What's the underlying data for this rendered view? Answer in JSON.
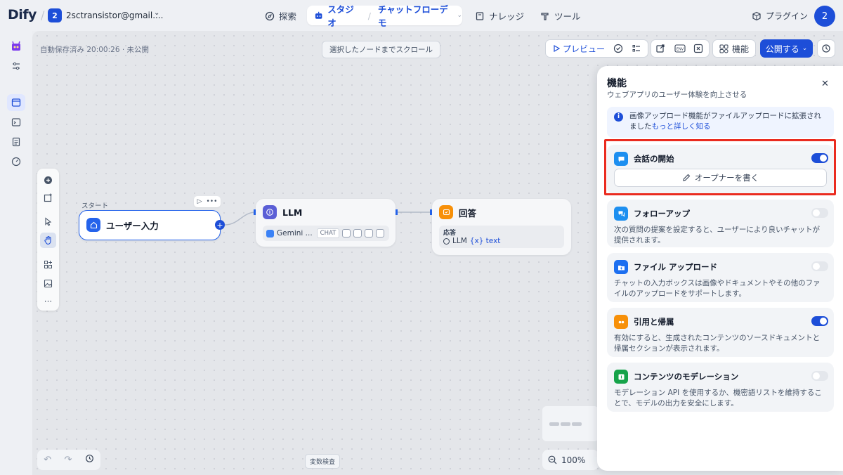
{
  "app": {
    "logo": "Dify",
    "workspace_badge": "2",
    "workspace_name": "2sctransistor@gmail...."
  },
  "nav": {
    "explore": "探索",
    "studio": "スタジオ",
    "app_name": "チャットフローデモ",
    "knowledge": "ナレッジ",
    "tools": "ツール",
    "plugins": "プラグイン",
    "avatar": "2"
  },
  "canvas": {
    "autosave": "自動保存済み 20:00:26 · 未公開",
    "scroll_to_node": "選択したノードまでスクロール",
    "preview": "プレビュー",
    "features": "機能",
    "publish": "公開する",
    "variable_inspect": "変数検査",
    "zoom": "100%"
  },
  "nodes": {
    "start_label": "スタート",
    "start_title": "ユーザー入力",
    "llm_title": "LLM",
    "llm_model": "Gemini ...",
    "llm_tag": "CHAT",
    "answer_title": "回答",
    "answer_label": "応答",
    "answer_source": "LLM",
    "answer_var": "{x} text"
  },
  "panel": {
    "title": "機能",
    "subtitle": "ウェブアプリのユーザー体験を向上させる",
    "info_text": "画像アップロード機能がファイルアップロードに拡張されました",
    "info_link": "もっと詳しく知る",
    "conversation_opener": {
      "title": "会話の開始",
      "enabled": true,
      "button": "オープナーを書く"
    },
    "follow_up": {
      "title": "フォローアップ",
      "enabled": false,
      "desc": "次の質問の提案を設定すると、ユーザーにより良いチャットが提供されます。"
    },
    "file_upload": {
      "title": "ファイル アップロード",
      "enabled": false,
      "desc": "チャットの入力ボックスは画像やドキュメントやその他のファイルのアップロードをサポートします。"
    },
    "citation": {
      "title": "引用と帰属",
      "enabled": true,
      "desc": "有効にすると、生成されたコンテンツのソースドキュメントと帰属セクションが表示されます。"
    },
    "moderation": {
      "title": "コンテンツのモデレーション",
      "enabled": false,
      "desc": "モデレーション API を使用するか、機密語リストを維持することで、モデルの出力を安全にします。"
    }
  },
  "colors": {
    "accent": "#1d4ed8",
    "highlight": "#ea2b1f"
  }
}
